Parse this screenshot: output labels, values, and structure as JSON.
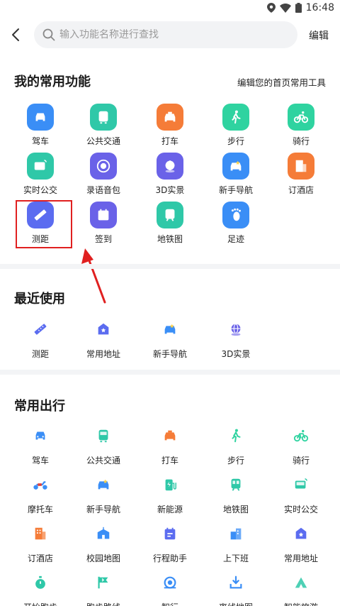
{
  "status_bar": {
    "time": "16:48"
  },
  "header": {
    "search_placeholder": "输入功能名称进行查找",
    "edit_label": "编辑"
  },
  "favorites": {
    "title": "我的常用功能",
    "edit_link": "编辑您的首页常用工具",
    "items": [
      {
        "label": "驾车",
        "icon": "car-icon",
        "color": "#3a8ef6"
      },
      {
        "label": "公共交通",
        "icon": "bus-icon",
        "color": "#2fc8a8"
      },
      {
        "label": "打车",
        "icon": "taxi-icon",
        "color": "#f57c38"
      },
      {
        "label": "步行",
        "icon": "walk-icon",
        "color": "#2fd3a0"
      },
      {
        "label": "骑行",
        "icon": "bike-icon",
        "color": "#2fd3a0"
      },
      {
        "label": "实时公交",
        "icon": "realtime-bus-icon",
        "color": "#2fc8a8"
      },
      {
        "label": "录语音包",
        "icon": "voice-record-icon",
        "color": "#6a62e8"
      },
      {
        "label": "3D实景",
        "icon": "globe-3d-icon",
        "color": "#6a62e8"
      },
      {
        "label": "新手导航",
        "icon": "novice-nav-icon",
        "color": "#3a8ef6"
      },
      {
        "label": "订酒店",
        "icon": "hotel-icon",
        "color": "#f57c38"
      },
      {
        "label": "测距",
        "icon": "ruler-icon",
        "color": "#5b6cf0"
      },
      {
        "label": "签到",
        "icon": "checkin-icon",
        "color": "#6a62e8"
      },
      {
        "label": "地铁图",
        "icon": "subway-icon",
        "color": "#2fc8a8"
      },
      {
        "label": "足迹",
        "icon": "footprint-icon",
        "color": "#3a8ef6"
      }
    ]
  },
  "recent": {
    "title": "最近使用",
    "items": [
      {
        "label": "测距",
        "icon": "ruler-icon"
      },
      {
        "label": "常用地址",
        "icon": "favorite-address-icon"
      },
      {
        "label": "新手导航",
        "icon": "novice-nav-icon"
      },
      {
        "label": "3D实景",
        "icon": "globe-3d-icon"
      }
    ]
  },
  "travel": {
    "title": "常用出行",
    "items": [
      {
        "label": "驾车",
        "icon": "car-icon"
      },
      {
        "label": "公共交通",
        "icon": "bus-icon"
      },
      {
        "label": "打车",
        "icon": "taxi-icon"
      },
      {
        "label": "步行",
        "icon": "walk-icon"
      },
      {
        "label": "骑行",
        "icon": "bike-icon"
      },
      {
        "label": "摩托车",
        "icon": "motorcycle-icon"
      },
      {
        "label": "新手导航",
        "icon": "novice-nav-icon"
      },
      {
        "label": "新能源",
        "icon": "ev-charging-icon"
      },
      {
        "label": "地铁图",
        "icon": "subway-icon"
      },
      {
        "label": "实时公交",
        "icon": "realtime-bus-icon"
      },
      {
        "label": "订酒店",
        "icon": "hotel-icon"
      },
      {
        "label": "校园地图",
        "icon": "campus-icon"
      },
      {
        "label": "行程助手",
        "icon": "trip-assistant-icon"
      },
      {
        "label": "上下班",
        "icon": "commute-icon"
      },
      {
        "label": "常用地址",
        "icon": "favorite-address-icon"
      },
      {
        "label": "开始跑步",
        "icon": "stopwatch-icon"
      },
      {
        "label": "跑步路线",
        "icon": "run-route-icon"
      },
      {
        "label": "智行",
        "icon": "smart-travel-icon"
      },
      {
        "label": "离线地图",
        "icon": "offline-map-icon"
      },
      {
        "label": "智能旅游",
        "icon": "smart-tour-icon"
      }
    ]
  }
}
